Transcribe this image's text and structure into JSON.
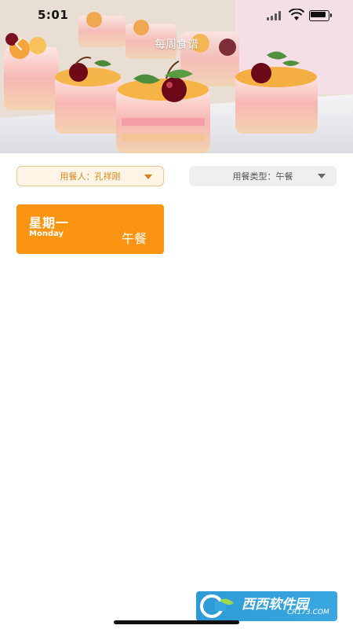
{
  "status_bar": {
    "time": "5:01"
  },
  "header": {
    "title": "每周食谱"
  },
  "filters": {
    "diner": {
      "label": "用餐人：孔祥刚"
    },
    "meal_type": {
      "label": "用餐类型：午餐"
    }
  },
  "days": [
    {
      "day_cn": "星期一",
      "day_en": "Monday",
      "meal": "午餐"
    }
  ],
  "watermark": {
    "main": "西西软件园",
    "site": "CR173.COM"
  },
  "colors": {
    "accent": "#fb9411",
    "accent_border": "#f2c58a",
    "filter_bg": "#fff4e6",
    "neutral_bg": "#efefef"
  },
  "icons": {
    "back": "chevron-left-icon",
    "dropdown": "caret-down-icon"
  }
}
